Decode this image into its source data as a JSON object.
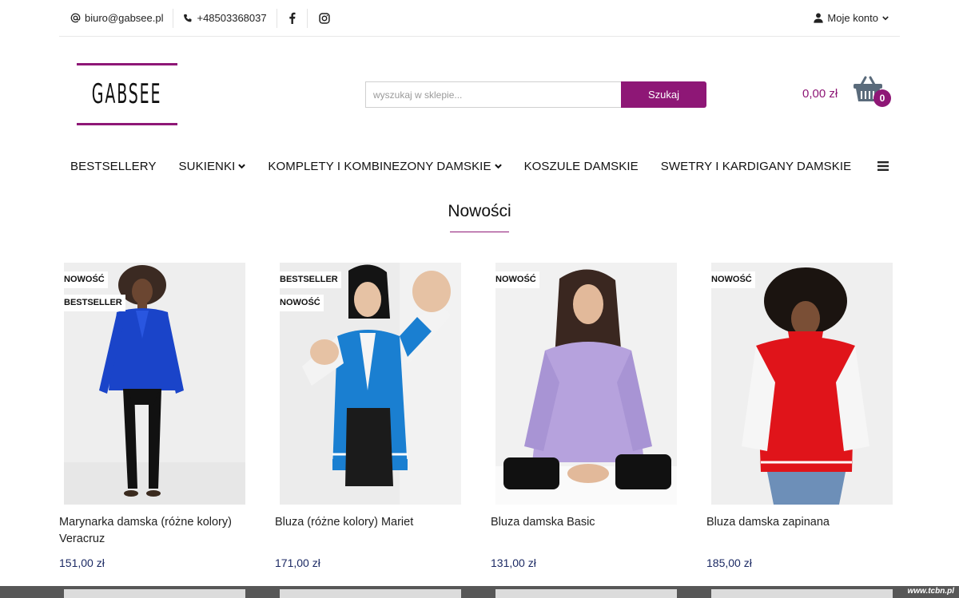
{
  "topbar": {
    "email": "biuro@gabsee.pl",
    "phone": "+48503368037",
    "account_label": "Moje konto"
  },
  "logo": {
    "text": "GABSEE"
  },
  "search": {
    "placeholder": "wyszukaj w sklepie...",
    "button_label": "Szukaj"
  },
  "cart": {
    "total": "0,00 zł",
    "count": "0"
  },
  "nav": {
    "items": [
      {
        "label": "BESTSELLERY"
      },
      {
        "label": "SUKIENKI"
      },
      {
        "label": "KOMPLETY I KOMBINEZONY DAMSKIE"
      },
      {
        "label": "KOSZULE DAMSKIE"
      },
      {
        "label": "SWETRY I KARDIGANY DAMSKIE"
      }
    ]
  },
  "section": {
    "title": "Nowości"
  },
  "products": [
    {
      "name": "Marynarka damska (różne kolory) Veracruz",
      "price": "151,00 zł",
      "badges": [
        "NOWOŚĆ",
        "BESTSELLER"
      ]
    },
    {
      "name": "Bluza (różne kolory) Mariet",
      "price": "171,00 zł",
      "badges": [
        "BESTSELLER",
        "NOWOŚĆ"
      ]
    },
    {
      "name": "Bluza damska Basic",
      "price": "131,00 zł",
      "badges": [
        "NOWOŚĆ"
      ]
    },
    {
      "name": "Bluza damska zapinana",
      "price": "185,00 zł",
      "badges": [
        "NOWOŚĆ"
      ]
    }
  ],
  "watermark": "www.tcbn.pl",
  "colors": {
    "accent": "#8e1776",
    "price": "#1c2a64"
  },
  "icons": [
    "at-icon",
    "phone-icon",
    "facebook-icon",
    "instagram-icon",
    "user-icon",
    "chevron-down-icon",
    "basket-icon",
    "menu-icon"
  ]
}
